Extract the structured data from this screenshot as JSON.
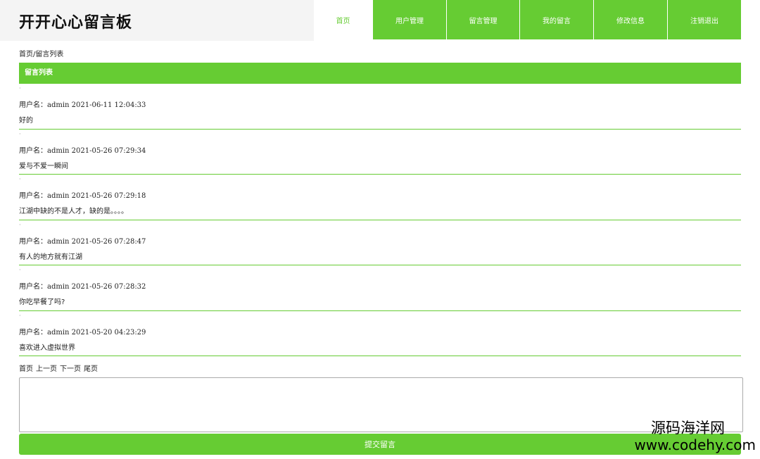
{
  "header": {
    "site_title": "开开心心留言板",
    "nav": [
      {
        "label": "首页",
        "active": true
      },
      {
        "label": "用户管理"
      },
      {
        "label": "留言管理"
      },
      {
        "label": "我的留言"
      },
      {
        "label": "修改信息"
      },
      {
        "label": "注销退出"
      }
    ]
  },
  "breadcrumb": "首页/留言列表",
  "section_title": "留言列表",
  "messages": [
    {
      "meta": "用户名：admin 2021-06-11 12:04:33",
      "content": "好的"
    },
    {
      "meta": "用户名：admin 2021-05-26 07:29:34",
      "content": "爱与不爱一瞬间"
    },
    {
      "meta": "用户名：admin 2021-05-26 07:29:18",
      "content": "江湖中缺的不是人才，缺的是。。。。"
    },
    {
      "meta": "用户名：admin 2021-05-26 07:28:47",
      "content": "有人的地方就有江湖"
    },
    {
      "meta": "用户名：admin 2021-05-26 07:28:32",
      "content": "你吃早餐了吗?"
    },
    {
      "meta": "用户名：admin 2021-05-20 04:23:29",
      "content": "喜欢进入虚拟世界"
    }
  ],
  "pager": {
    "first": "首页",
    "prev": "上一页",
    "next": "下一页",
    "last": "尾页"
  },
  "form": {
    "textarea_value": "",
    "submit_label": "提交留言"
  },
  "watermark": {
    "cn": "源码海洋网",
    "url": "www.codehy.com"
  },
  "colors": {
    "accent": "#66cc33"
  }
}
